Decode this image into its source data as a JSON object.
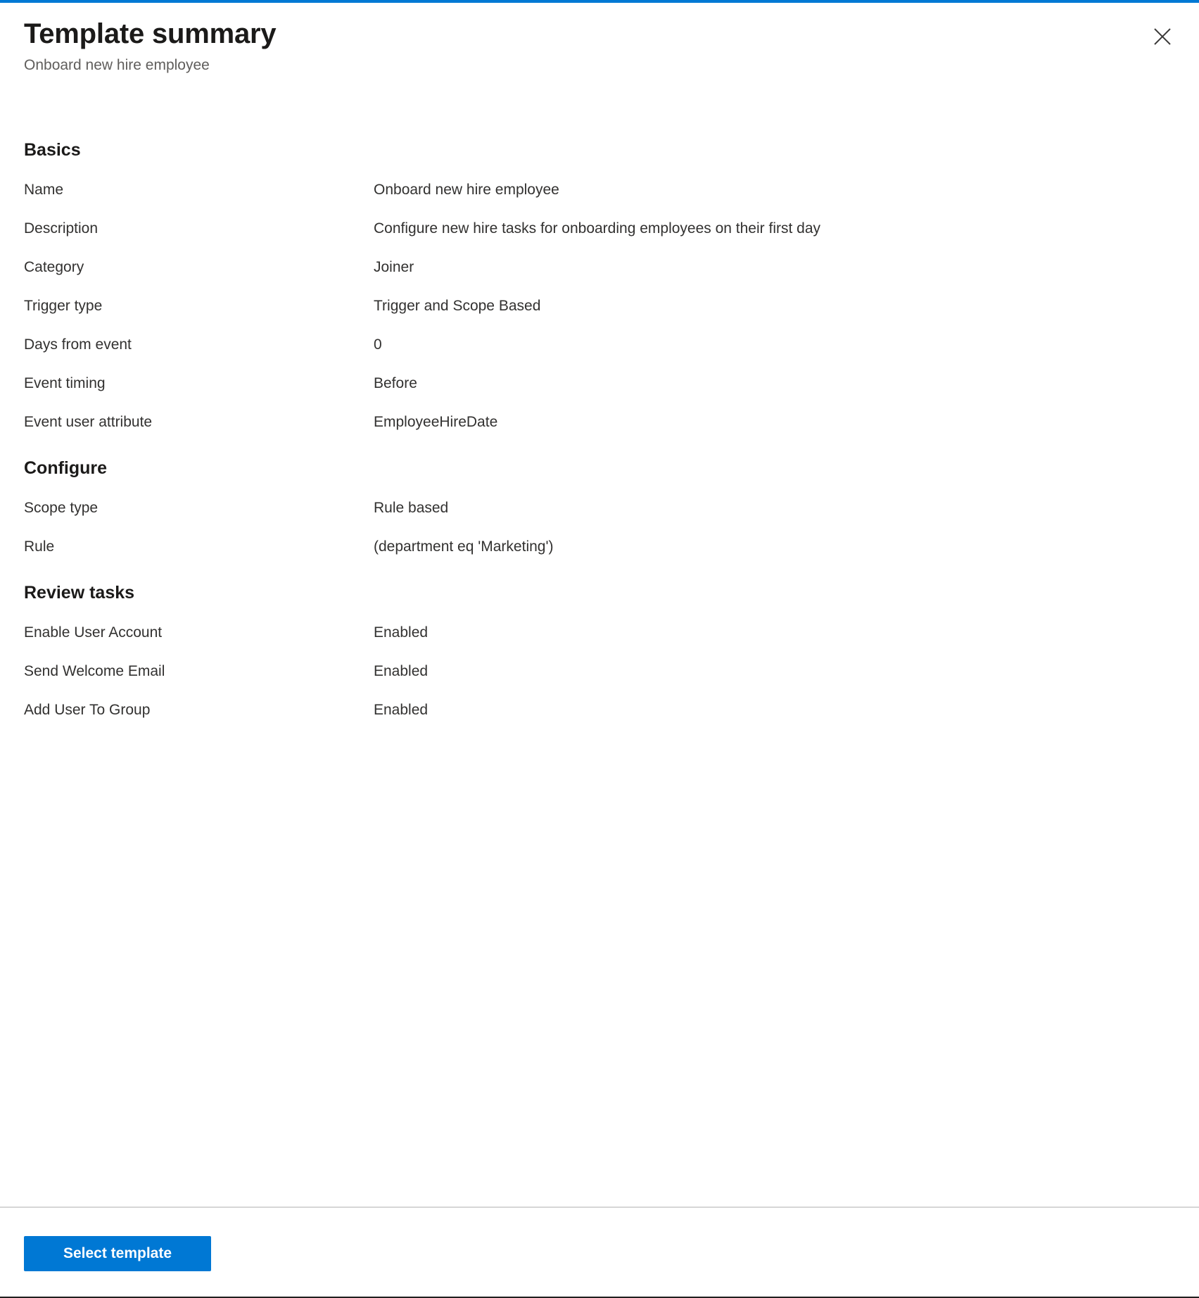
{
  "header": {
    "title": "Template summary",
    "subtitle": "Onboard new hire employee",
    "close_icon": "close-icon",
    "accent_color": "#0078d4"
  },
  "sections": [
    {
      "heading": "Basics",
      "rows": [
        {
          "label": "Name",
          "value": "Onboard new hire employee"
        },
        {
          "label": "Description",
          "value": "Configure new hire tasks for onboarding employees on their first day"
        },
        {
          "label": "Category",
          "value": "Joiner"
        },
        {
          "label": "Trigger type",
          "value": "Trigger and Scope Based"
        },
        {
          "label": "Days from event",
          "value": "0"
        },
        {
          "label": "Event timing",
          "value": "Before"
        },
        {
          "label": "Event user attribute",
          "value": "EmployeeHireDate"
        }
      ]
    },
    {
      "heading": "Configure",
      "rows": [
        {
          "label": "Scope type",
          "value": "Rule based"
        },
        {
          "label": "Rule",
          "value": "(department eq 'Marketing')"
        }
      ]
    },
    {
      "heading": "Review tasks",
      "rows": [
        {
          "label": "Enable User Account",
          "value": "Enabled"
        },
        {
          "label": "Send Welcome Email",
          "value": "Enabled"
        },
        {
          "label": "Add User To Group",
          "value": "Enabled"
        }
      ]
    }
  ],
  "footer": {
    "primary_button_label": "Select template",
    "primary_button_color": "#0078d4"
  }
}
